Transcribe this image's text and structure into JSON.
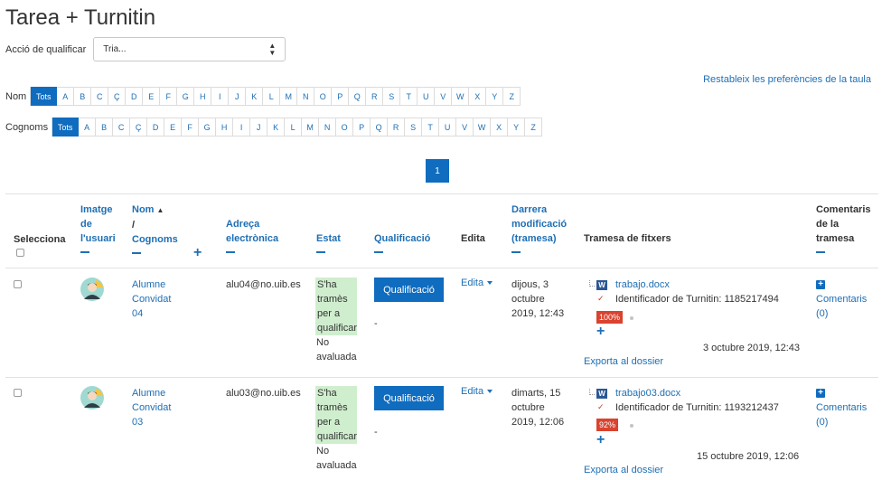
{
  "page": {
    "title": "Tarea + Turnitin"
  },
  "grading_action": {
    "label": "Acció de qualificar",
    "selected": "Tria..."
  },
  "reset_link": "Restableix les preferències de la taula",
  "initials_first": {
    "label": "Nom",
    "all": "Tots",
    "letters": [
      "A",
      "B",
      "C",
      "Ç",
      "D",
      "E",
      "F",
      "G",
      "H",
      "I",
      "J",
      "K",
      "L",
      "M",
      "N",
      "O",
      "P",
      "Q",
      "R",
      "S",
      "T",
      "U",
      "V",
      "W",
      "X",
      "Y",
      "Z"
    ]
  },
  "initials_last": {
    "label": "Cognoms",
    "all": "Tots",
    "letters": [
      "A",
      "B",
      "C",
      "Ç",
      "D",
      "E",
      "F",
      "G",
      "H",
      "I",
      "J",
      "K",
      "L",
      "M",
      "N",
      "O",
      "P",
      "Q",
      "R",
      "S",
      "T",
      "U",
      "V",
      "W",
      "X",
      "Y",
      "Z"
    ]
  },
  "paging": {
    "current": "1"
  },
  "columns": {
    "select": "Selecciona",
    "picture": [
      "Imatge",
      "de",
      "l'usuari"
    ],
    "name": [
      "Nom",
      "/",
      "Cognoms"
    ],
    "email": [
      "Adreça",
      "electrònica"
    ],
    "status": "Estat",
    "grade": "Qualificació",
    "edit": "Edita",
    "last_modified": [
      "Darrera",
      "modificació",
      "(tramesa)"
    ],
    "files": "Tramesa de fitxers",
    "comments": [
      "Comentaris",
      "de la",
      "tramesa"
    ]
  },
  "rows": [
    {
      "name": [
        "Alumne",
        "Convidat",
        "04"
      ],
      "email": "alu04@no.uib.es",
      "status": [
        "S'ha",
        "tramès",
        "per a",
        "qualificar"
      ],
      "status_sub": [
        "No",
        "avaluada"
      ],
      "grade_button": "Qualificació",
      "grade_value": "-",
      "edit": "Edita",
      "modified": [
        "dijous, 3",
        "octubre",
        "2019, 12:43"
      ],
      "file_name": "trabajo.docx",
      "turnitin_id": "Identificador de Turnitin: 1185217494",
      "similarity": "100%",
      "file_date": "3 octubre 2019, 12:43",
      "export": "Exporta al dossier",
      "comments": [
        "Comentaris",
        "(0)"
      ]
    },
    {
      "name": [
        "Alumne",
        "Convidat",
        "03"
      ],
      "email": "alu03@no.uib.es",
      "status": [
        "S'ha",
        "tramès",
        "per a",
        "qualificar"
      ],
      "status_sub": [
        "No",
        "avaluada"
      ],
      "grade_button": "Qualificació",
      "grade_value": "-",
      "edit": "Edita",
      "modified": [
        "dimarts, 15",
        "octubre",
        "2019, 12:06"
      ],
      "file_name": "trabajo03.docx",
      "turnitin_id": "Identificador de Turnitin: 1193212437",
      "similarity": "92%",
      "file_date": "15 octubre 2019, 12:06",
      "export": "Exporta al dossier",
      "comments": [
        "Comentaris",
        "(0)"
      ]
    }
  ]
}
